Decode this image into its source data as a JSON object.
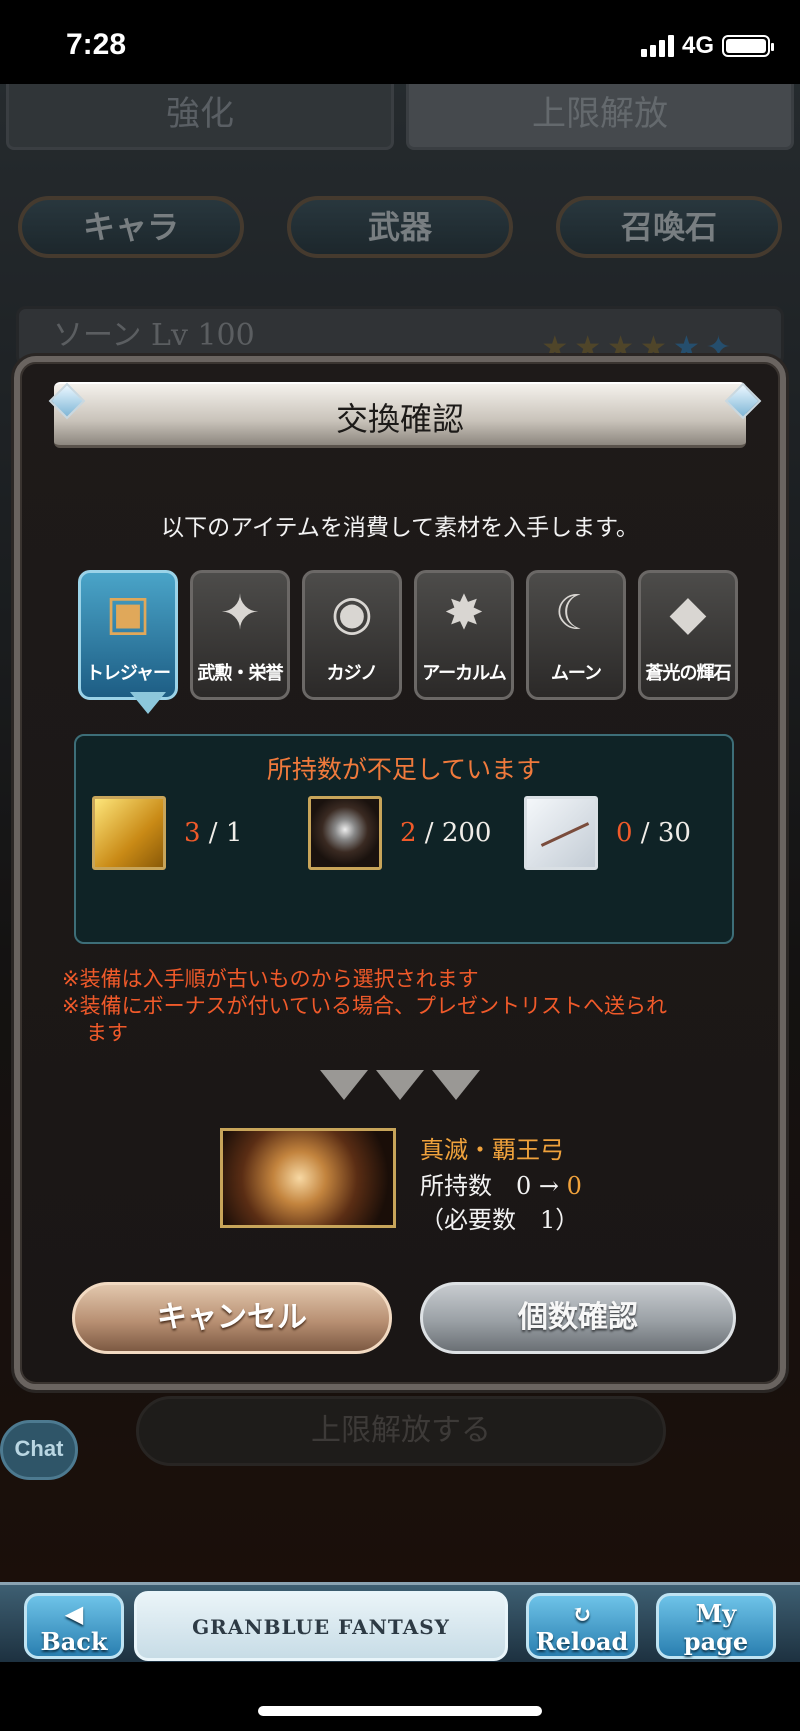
{
  "status": {
    "time": "7:28",
    "network": "4G",
    "battery_level": 1.0
  },
  "background": {
    "tabs": [
      "強化",
      "上限解放"
    ],
    "categories": [
      "キャラ",
      "武器",
      "召喚石"
    ],
    "character": "ソーン Lv 100",
    "unlock_button": "上限解放する",
    "chat": "Chat"
  },
  "modal": {
    "title": "交換確認",
    "message": "以下のアイテムを消費して素材を入手します。",
    "categories": [
      {
        "label": "トレジャー",
        "icon": "treasure-chest-icon",
        "active": true
      },
      {
        "label": "武勲・栄誉",
        "icon": "cards-icon",
        "active": false
      },
      {
        "label": "カジノ",
        "icon": "casino-chip-icon",
        "active": false
      },
      {
        "label": "アーカルム",
        "icon": "arcarum-star-icon",
        "active": false
      },
      {
        "label": "ムーン",
        "icon": "moon-icon",
        "active": false
      },
      {
        "label": "蒼光の輝石",
        "icon": "crystal-icon",
        "active": false
      }
    ],
    "warning": "所持数が不足しています",
    "materials": [
      {
        "icon": "gold-bar-icon",
        "have": "3",
        "need": "1"
      },
      {
        "icon": "rune-orb-icon",
        "have": "2",
        "need": "200"
      },
      {
        "icon": "bow-item-icon",
        "have": "0",
        "need": "30"
      }
    ],
    "note1": "※装備は入手順が古いものから選択されます",
    "note2": "※装備にボーナスが付いている場合、プレゼントリストへ送られ",
    "note2_cont": "ます",
    "result": {
      "name": "真滅・覇王弓",
      "own_label": "所持数",
      "own_from": "0",
      "own_arrow": "→",
      "own_to": "0",
      "need": "（必要数　1）"
    },
    "cancel_label": "キャンセル",
    "confirm_label": "個数確認"
  },
  "nav": {
    "back": "Back",
    "logo": "GRANBLUE FANTASY",
    "reload": "Reload",
    "mypage_line1": "My",
    "mypage_line2": "page"
  },
  "colors": {
    "warning": "#f05a2a",
    "accent": "#f0a23c",
    "active_tab": "#2a7fb0"
  }
}
